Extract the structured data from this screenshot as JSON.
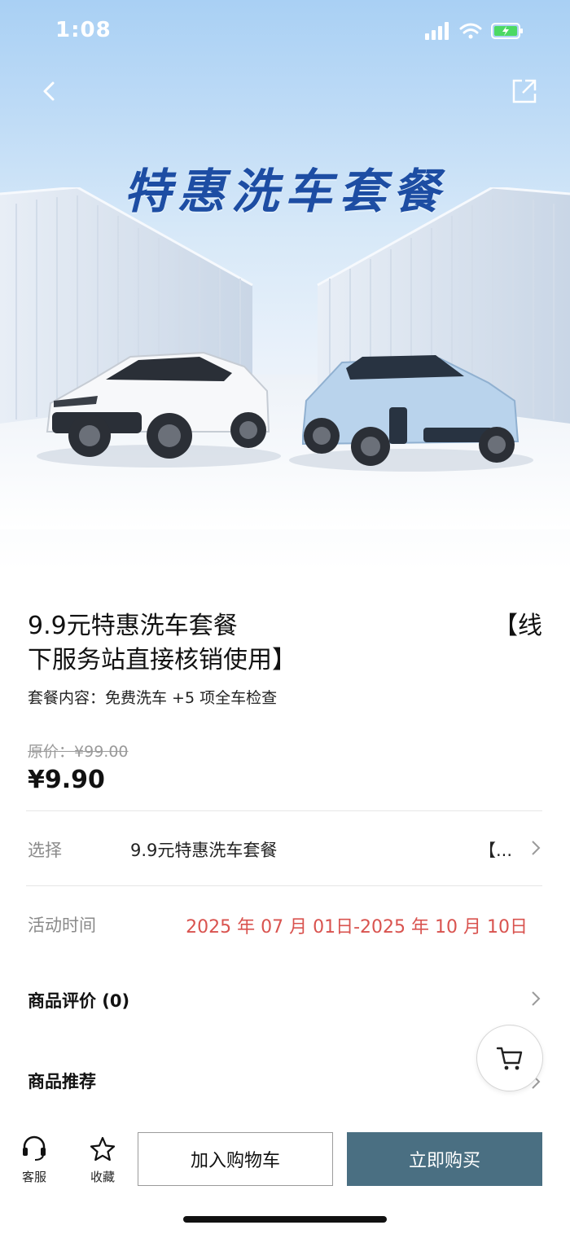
{
  "status_bar": {
    "time": "1:08"
  },
  "banner": {
    "title": "特惠洗车套餐"
  },
  "product": {
    "title_line1_left": "9.9元特惠洗车套餐",
    "title_line1_right": "【线",
    "title_line2": "下服务站直接核销使用】",
    "subtitle": "套餐内容：免费洗车 +5 项全车检查",
    "original_price_label": "原价：",
    "original_price": "¥99.00",
    "price": "¥9.90"
  },
  "options": {
    "select_label": "选择",
    "select_value": "9.9元特惠洗车套餐",
    "select_tail": "【...",
    "activity_label": "活动时间",
    "activity_value": "2025 年 07 月 01日-2025 年 10 月 10日"
  },
  "sections": {
    "reviews": "商品评价 (0)",
    "recommend": "商品推荐"
  },
  "bottom_bar": {
    "service_label": "客服",
    "favorite_label": "收藏",
    "add_to_cart": "加入购物车",
    "buy_now": "立即购买"
  },
  "colors": {
    "accent": "#4a6f82",
    "date_red": "#d9534f",
    "banner_title": "#1d4da3"
  },
  "icons": [
    "back-icon",
    "share-icon",
    "signal-icon",
    "wifi-icon",
    "battery-icon",
    "cart-icon",
    "headset-icon",
    "star-icon",
    "chevron-right-icon"
  ]
}
